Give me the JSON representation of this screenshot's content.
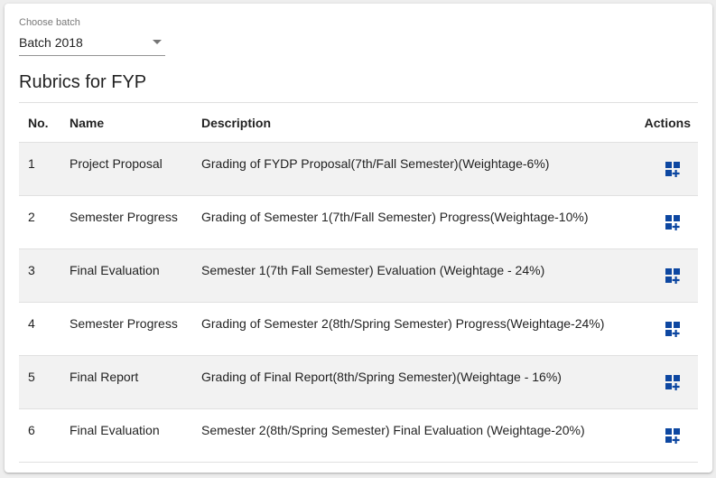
{
  "batch": {
    "label": "Choose batch",
    "value": "Batch 2018"
  },
  "title": "Rubrics for FYP",
  "table": {
    "headers": {
      "no": "No.",
      "name": "Name",
      "description": "Description",
      "actions": "Actions"
    },
    "rows": [
      {
        "no": "1",
        "name": "Project Proposal",
        "description": "Grading of FYDP Proposal(7th/Fall Semester)(Weightage-6%)"
      },
      {
        "no": "2",
        "name": "Semester Progress",
        "description": "Grading of Semester 1(7th/Fall Semester) Progress(Weightage-10%)"
      },
      {
        "no": "3",
        "name": "Final Evaluation",
        "description": "Semester 1(7th Fall Semester) Evaluation (Weightage - 24%)"
      },
      {
        "no": "4",
        "name": "Semester Progress",
        "description": "Grading of Semester 2(8th/Spring Semester) Progress(Weightage-24%)"
      },
      {
        "no": "5",
        "name": "Final Report",
        "description": "Grading of Final Report(8th/Spring Semester)(Weightage - 16%)"
      },
      {
        "no": "6",
        "name": "Final Evaluation",
        "description": "Semester 2(8th/Spring Semester) Final Evaluation (Weightage-20%)"
      }
    ]
  },
  "icons": {
    "action": "add-to-grid-icon"
  },
  "colors": {
    "action_icon": "#0d47a1",
    "row_stripe": "#f2f2f2"
  }
}
